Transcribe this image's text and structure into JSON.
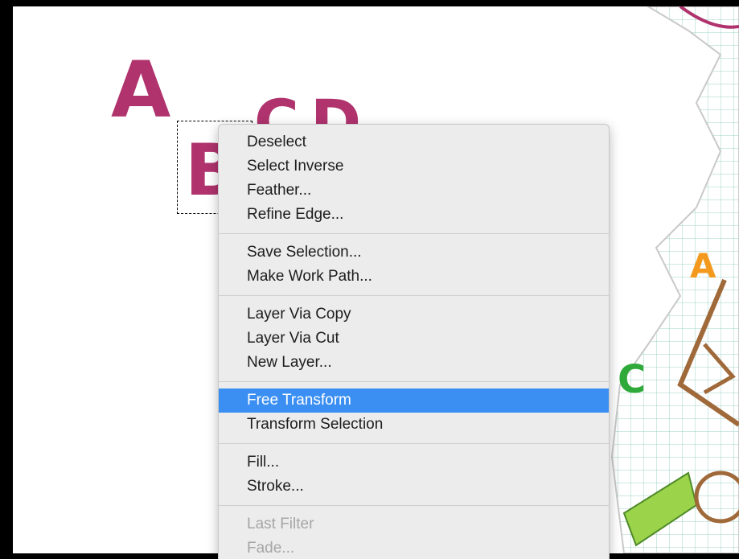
{
  "canvas": {
    "letters_left": [
      "A",
      "B",
      "C",
      "D"
    ],
    "letters_right": [
      "A",
      "C"
    ]
  },
  "context_menu": {
    "groups": [
      [
        {
          "label": "Deselect",
          "state": "normal"
        },
        {
          "label": "Select Inverse",
          "state": "normal"
        },
        {
          "label": "Feather...",
          "state": "normal"
        },
        {
          "label": "Refine Edge...",
          "state": "normal"
        }
      ],
      [
        {
          "label": "Save Selection...",
          "state": "normal"
        },
        {
          "label": "Make Work Path...",
          "state": "normal"
        }
      ],
      [
        {
          "label": "Layer Via Copy",
          "state": "normal"
        },
        {
          "label": "Layer Via Cut",
          "state": "normal"
        },
        {
          "label": "New Layer...",
          "state": "normal"
        }
      ],
      [
        {
          "label": "Free Transform",
          "state": "highlighted"
        },
        {
          "label": "Transform Selection",
          "state": "normal"
        }
      ],
      [
        {
          "label": "Fill...",
          "state": "normal"
        },
        {
          "label": "Stroke...",
          "state": "normal"
        }
      ],
      [
        {
          "label": "Last Filter",
          "state": "disabled"
        },
        {
          "label": "Fade...",
          "state": "disabled"
        }
      ]
    ]
  },
  "colors": {
    "highlight": "#3b8ff2",
    "magenta_letters": "#b0336e",
    "orange_letter": "#f39a1e",
    "green_letter": "#2faa3a",
    "brown_sketch": "#a0693a"
  }
}
